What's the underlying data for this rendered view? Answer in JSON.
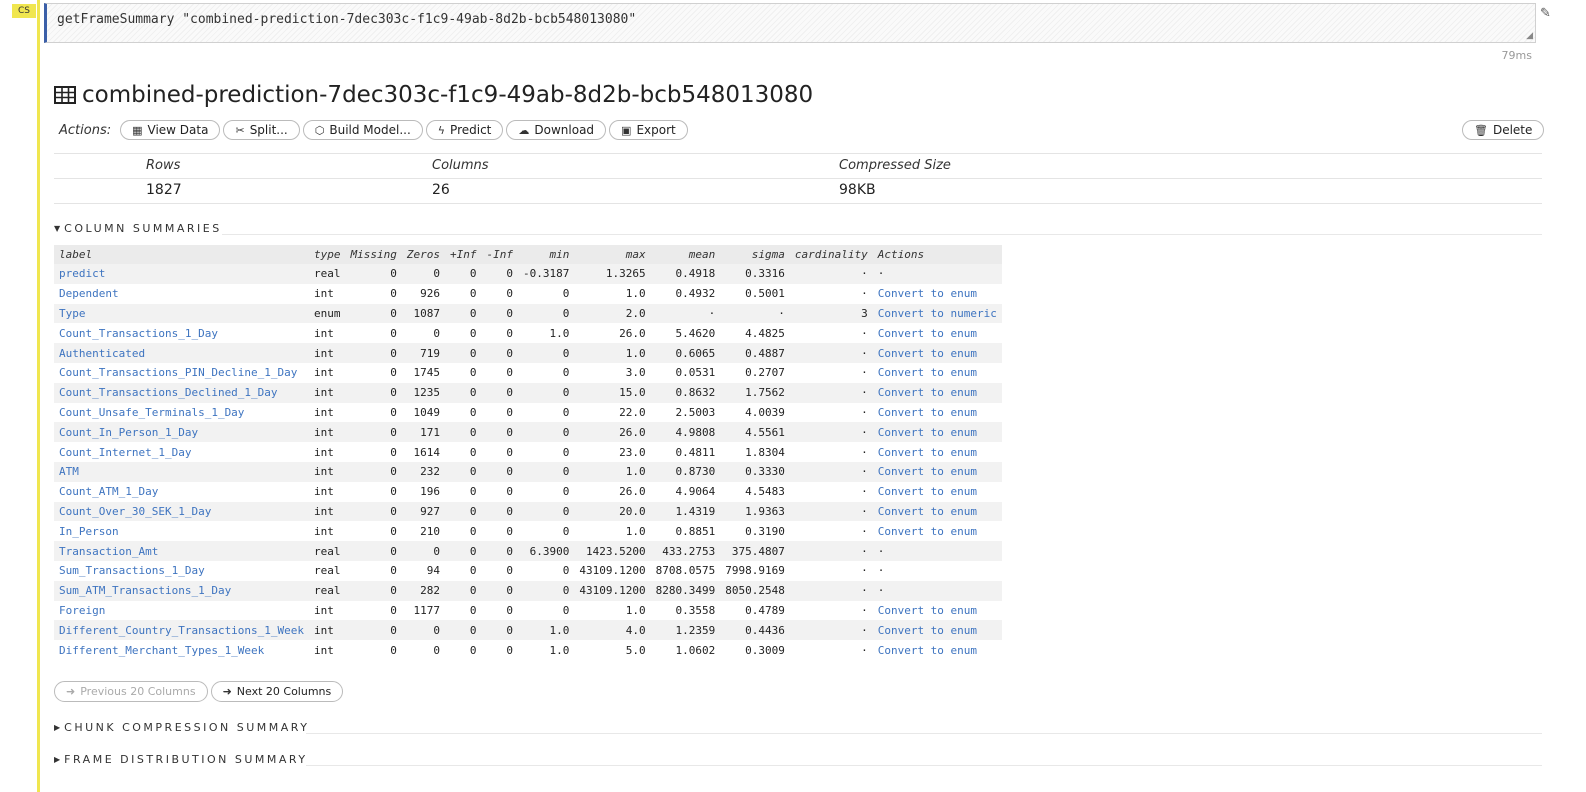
{
  "cell": {
    "tag": "CS",
    "code": "getFrameSummary \"combined-prediction-7dec303c-f1c9-49ab-8d2b-bcb548013080\"",
    "timing": "79ms"
  },
  "frame": {
    "title": "combined-prediction-7dec303c-f1c9-49ab-8d2b-bcb548013080",
    "icon": "table-icon"
  },
  "actions": {
    "label": "Actions:",
    "view_data": "View Data",
    "split": "Split...",
    "build_model": "Build Model...",
    "predict": "Predict",
    "download": "Download",
    "export": "Export",
    "delete": "Delete"
  },
  "summary": {
    "rows_label": "Rows",
    "rows": "1827",
    "columns_label": "Columns",
    "columns": "26",
    "size_label": "Compressed Size",
    "size": "98KB"
  },
  "sections": {
    "column_summaries": "COLUMN SUMMARIES",
    "chunk": "CHUNK COMPRESSION SUMMARY",
    "distribution": "FRAME DISTRIBUTION SUMMARY"
  },
  "table": {
    "headers": [
      "label",
      "type",
      "Missing",
      "Zeros",
      "+Inf",
      "-Inf",
      "min",
      "max",
      "mean",
      "sigma",
      "cardinality",
      "Actions"
    ],
    "rows": [
      {
        "label": "predict",
        "type": "real",
        "missing": "0",
        "zeros": "0",
        "pinf": "0",
        "ninf": "0",
        "min": "-0.3187",
        "max": "1.3265",
        "mean": "0.4918",
        "sigma": "0.3316",
        "card": "·",
        "action": "·"
      },
      {
        "label": "Dependent",
        "type": "int",
        "missing": "0",
        "zeros": "926",
        "pinf": "0",
        "ninf": "0",
        "min": "0",
        "max": "1.0",
        "mean": "0.4932",
        "sigma": "0.5001",
        "card": "·",
        "action": "Convert to enum"
      },
      {
        "label": "Type",
        "type": "enum",
        "missing": "0",
        "zeros": "1087",
        "pinf": "0",
        "ninf": "0",
        "min": "0",
        "max": "2.0",
        "mean": "·",
        "sigma": "·",
        "card": "3",
        "action": "Convert to numeric"
      },
      {
        "label": "Count_Transactions_1_Day",
        "type": "int",
        "missing": "0",
        "zeros": "0",
        "pinf": "0",
        "ninf": "0",
        "min": "1.0",
        "max": "26.0",
        "mean": "5.4620",
        "sigma": "4.4825",
        "card": "·",
        "action": "Convert to enum"
      },
      {
        "label": "Authenticated",
        "type": "int",
        "missing": "0",
        "zeros": "719",
        "pinf": "0",
        "ninf": "0",
        "min": "0",
        "max": "1.0",
        "mean": "0.6065",
        "sigma": "0.4887",
        "card": "·",
        "action": "Convert to enum"
      },
      {
        "label": "Count_Transactions_PIN_Decline_1_Day",
        "type": "int",
        "missing": "0",
        "zeros": "1745",
        "pinf": "0",
        "ninf": "0",
        "min": "0",
        "max": "3.0",
        "mean": "0.0531",
        "sigma": "0.2707",
        "card": "·",
        "action": "Convert to enum"
      },
      {
        "label": "Count_Transactions_Declined_1_Day",
        "type": "int",
        "missing": "0",
        "zeros": "1235",
        "pinf": "0",
        "ninf": "0",
        "min": "0",
        "max": "15.0",
        "mean": "0.8632",
        "sigma": "1.7562",
        "card": "·",
        "action": "Convert to enum"
      },
      {
        "label": "Count_Unsafe_Terminals_1_Day",
        "type": "int",
        "missing": "0",
        "zeros": "1049",
        "pinf": "0",
        "ninf": "0",
        "min": "0",
        "max": "22.0",
        "mean": "2.5003",
        "sigma": "4.0039",
        "card": "·",
        "action": "Convert to enum"
      },
      {
        "label": "Count_In_Person_1_Day",
        "type": "int",
        "missing": "0",
        "zeros": "171",
        "pinf": "0",
        "ninf": "0",
        "min": "0",
        "max": "26.0",
        "mean": "4.9808",
        "sigma": "4.5561",
        "card": "·",
        "action": "Convert to enum"
      },
      {
        "label": "Count_Internet_1_Day",
        "type": "int",
        "missing": "0",
        "zeros": "1614",
        "pinf": "0",
        "ninf": "0",
        "min": "0",
        "max": "23.0",
        "mean": "0.4811",
        "sigma": "1.8304",
        "card": "·",
        "action": "Convert to enum"
      },
      {
        "label": "ATM",
        "type": "int",
        "missing": "0",
        "zeros": "232",
        "pinf": "0",
        "ninf": "0",
        "min": "0",
        "max": "1.0",
        "mean": "0.8730",
        "sigma": "0.3330",
        "card": "·",
        "action": "Convert to enum"
      },
      {
        "label": "Count_ATM_1_Day",
        "type": "int",
        "missing": "0",
        "zeros": "196",
        "pinf": "0",
        "ninf": "0",
        "min": "0",
        "max": "26.0",
        "mean": "4.9064",
        "sigma": "4.5483",
        "card": "·",
        "action": "Convert to enum"
      },
      {
        "label": "Count_Over_30_SEK_1_Day",
        "type": "int",
        "missing": "0",
        "zeros": "927",
        "pinf": "0",
        "ninf": "0",
        "min": "0",
        "max": "20.0",
        "mean": "1.4319",
        "sigma": "1.9363",
        "card": "·",
        "action": "Convert to enum"
      },
      {
        "label": "In_Person",
        "type": "int",
        "missing": "0",
        "zeros": "210",
        "pinf": "0",
        "ninf": "0",
        "min": "0",
        "max": "1.0",
        "mean": "0.8851",
        "sigma": "0.3190",
        "card": "·",
        "action": "Convert to enum"
      },
      {
        "label": "Transaction_Amt",
        "type": "real",
        "missing": "0",
        "zeros": "0",
        "pinf": "0",
        "ninf": "0",
        "min": "6.3900",
        "max": "1423.5200",
        "mean": "433.2753",
        "sigma": "375.4807",
        "card": "·",
        "action": "·"
      },
      {
        "label": "Sum_Transactions_1_Day",
        "type": "real",
        "missing": "0",
        "zeros": "94",
        "pinf": "0",
        "ninf": "0",
        "min": "0",
        "max": "43109.1200",
        "mean": "8708.0575",
        "sigma": "7998.9169",
        "card": "·",
        "action": "·"
      },
      {
        "label": "Sum_ATM_Transactions_1_Day",
        "type": "real",
        "missing": "0",
        "zeros": "282",
        "pinf": "0",
        "ninf": "0",
        "min": "0",
        "max": "43109.1200",
        "mean": "8280.3499",
        "sigma": "8050.2548",
        "card": "·",
        "action": "·"
      },
      {
        "label": "Foreign",
        "type": "int",
        "missing": "0",
        "zeros": "1177",
        "pinf": "0",
        "ninf": "0",
        "min": "0",
        "max": "1.0",
        "mean": "0.3558",
        "sigma": "0.4789",
        "card": "·",
        "action": "Convert to enum"
      },
      {
        "label": "Different_Country_Transactions_1_Week",
        "type": "int",
        "missing": "0",
        "zeros": "0",
        "pinf": "0",
        "ninf": "0",
        "min": "1.0",
        "max": "4.0",
        "mean": "1.2359",
        "sigma": "0.4436",
        "card": "·",
        "action": "Convert to enum"
      },
      {
        "label": "Different_Merchant_Types_1_Week",
        "type": "int",
        "missing": "0",
        "zeros": "0",
        "pinf": "0",
        "ninf": "0",
        "min": "1.0",
        "max": "5.0",
        "mean": "1.0602",
        "sigma": "0.3009",
        "card": "·",
        "action": "Convert to enum"
      }
    ]
  },
  "pager": {
    "prev": "Previous 20 Columns",
    "next": "Next 20 Columns"
  }
}
